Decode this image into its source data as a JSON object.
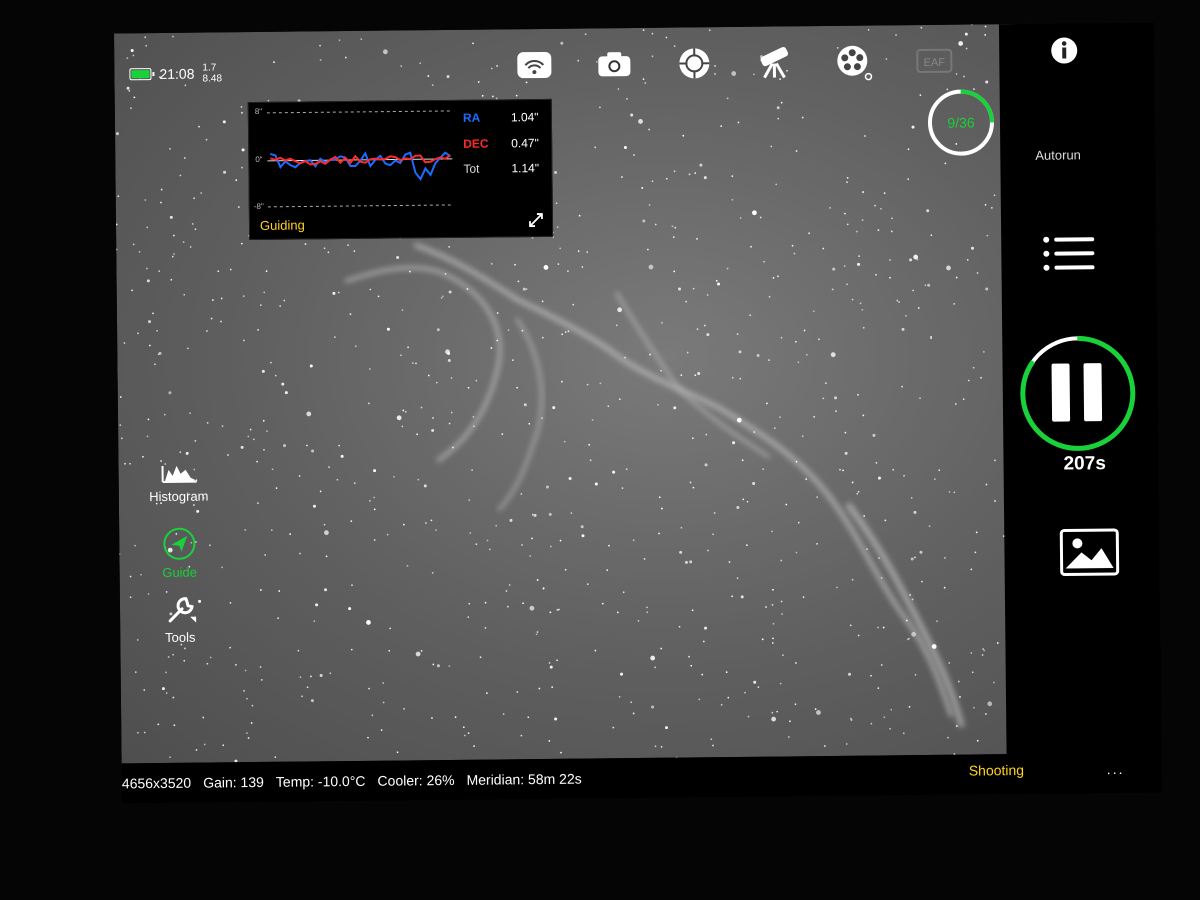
{
  "status": {
    "time": "21:08",
    "value_top": "1.7",
    "value_bottom": "8.48",
    "battery_color": "#19d13a"
  },
  "top_icons": [
    "wifi-icon",
    "camera-icon",
    "focus-target-icon",
    "telescope-mount-icon",
    "filter-wheel-icon",
    "eaf-icon",
    "usb-storage-icon"
  ],
  "eaf_label": "EAF",
  "guide_panel": {
    "title": "Guiding",
    "axis_top": "8\"",
    "axis_mid": "0\"",
    "axis_bottom": "-8\"",
    "ra_label": "RA",
    "ra_value": "1.04\"",
    "dec_label": "DEC",
    "dec_value": "0.47\"",
    "tot_label": "Tot",
    "tot_value": "1.14\"",
    "ra_color": "#1e6bff",
    "dec_color": "#ff2a2a",
    "title_color": "#ffd21e"
  },
  "left_tools": {
    "histogram": "Histogram",
    "guide": "Guide",
    "tools": "Tools",
    "active_color": "#19d13a"
  },
  "right_panel": {
    "progress": "9/36",
    "progress_fraction": 0.25,
    "autorun": "Autorun",
    "countdown": "207s",
    "pause_progress_fraction": 0.85
  },
  "bottom_bar": {
    "resolution": "4656x3520",
    "gain": "Gain: 139",
    "temp": "Temp: -10.0°C",
    "cooler": "Cooler: 26%",
    "meridian": "Meridian: 58m 22s",
    "status": "Shooting",
    "more": "..."
  }
}
